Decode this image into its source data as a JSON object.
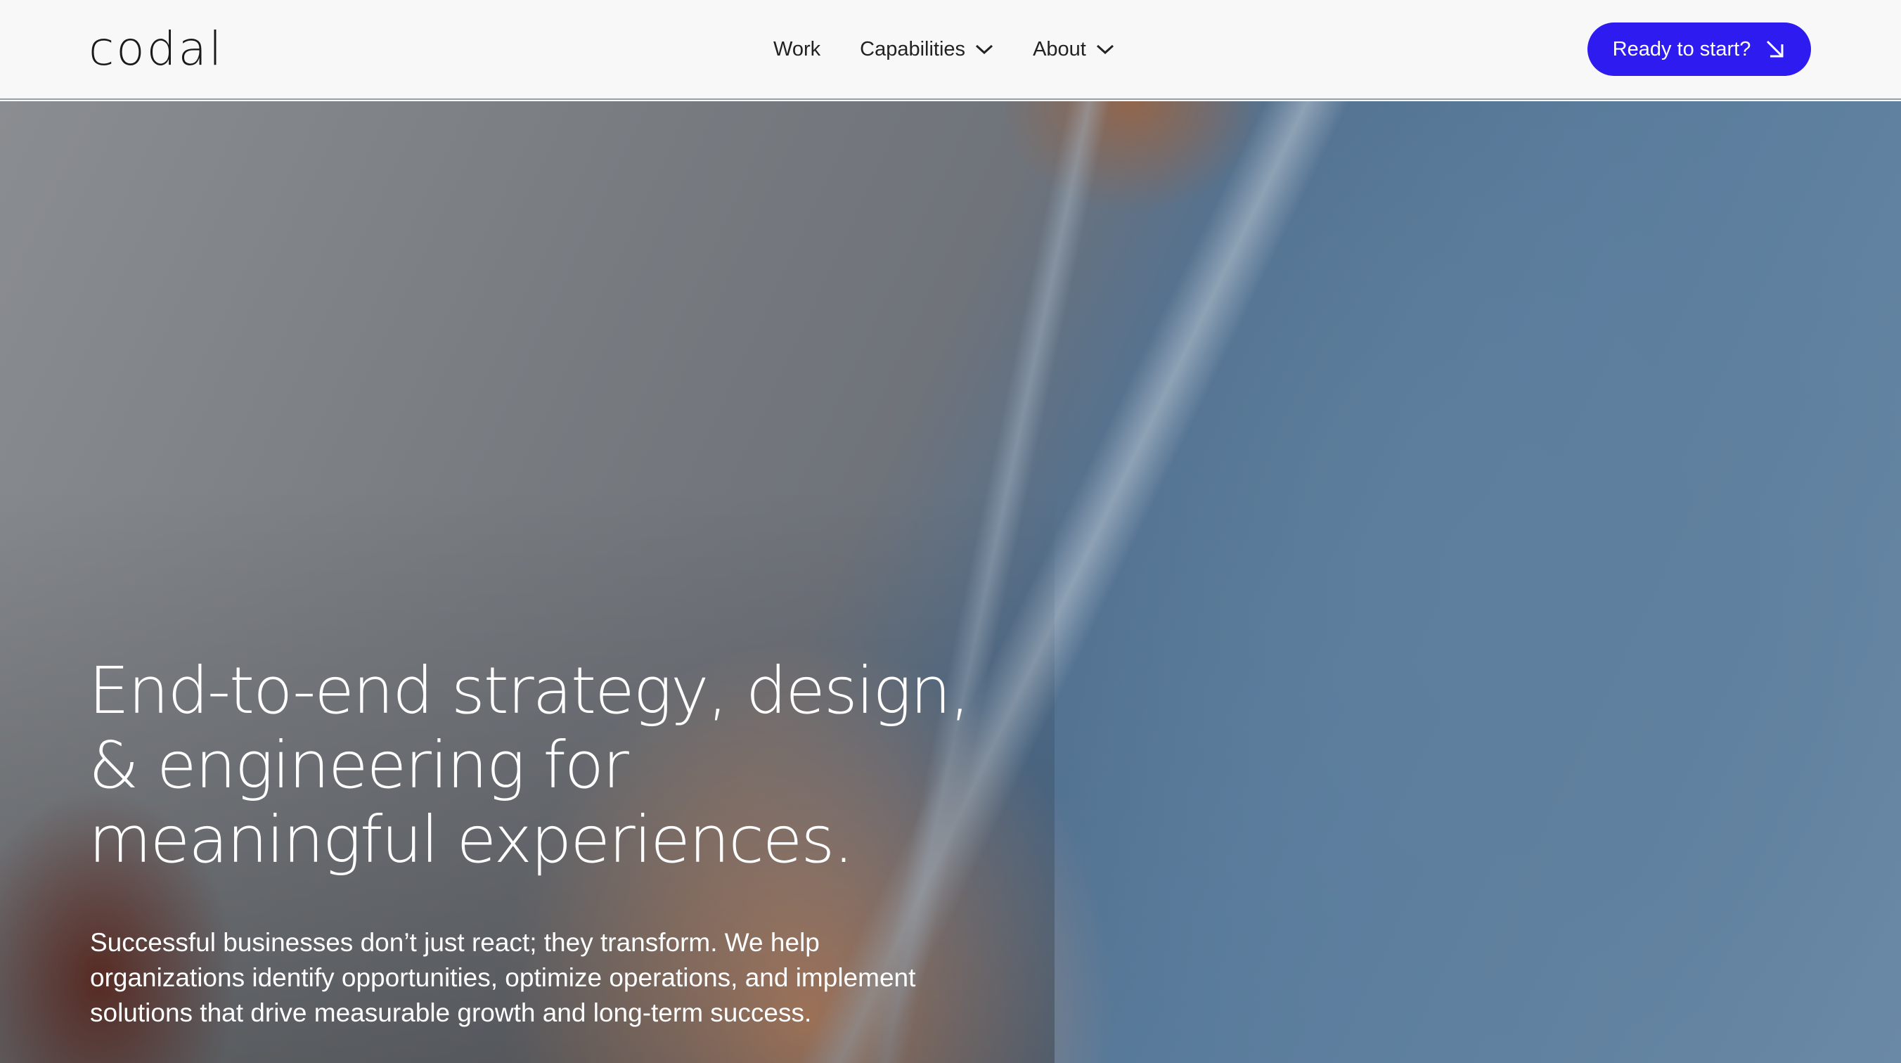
{
  "header": {
    "logo": "codal",
    "nav": [
      {
        "label": "Work",
        "has_dropdown": false
      },
      {
        "label": "Capabilities",
        "has_dropdown": true
      },
      {
        "label": "About",
        "has_dropdown": true
      }
    ],
    "cta_label": "Ready to start?",
    "cta_icon": "arrow-down-right-icon"
  },
  "hero": {
    "headline": "End-to-end strategy, design, & engineering for meaningful experiences.",
    "subtext": "Successful businesses don’t just react; they transform. We help organizations identify opportunities, optimize operations, and implement solutions that drive measurable growth and long-term success."
  },
  "colors": {
    "accent": "#2d1bf0",
    "header_bg": "#f8f8f8",
    "text_dark": "#222222"
  }
}
